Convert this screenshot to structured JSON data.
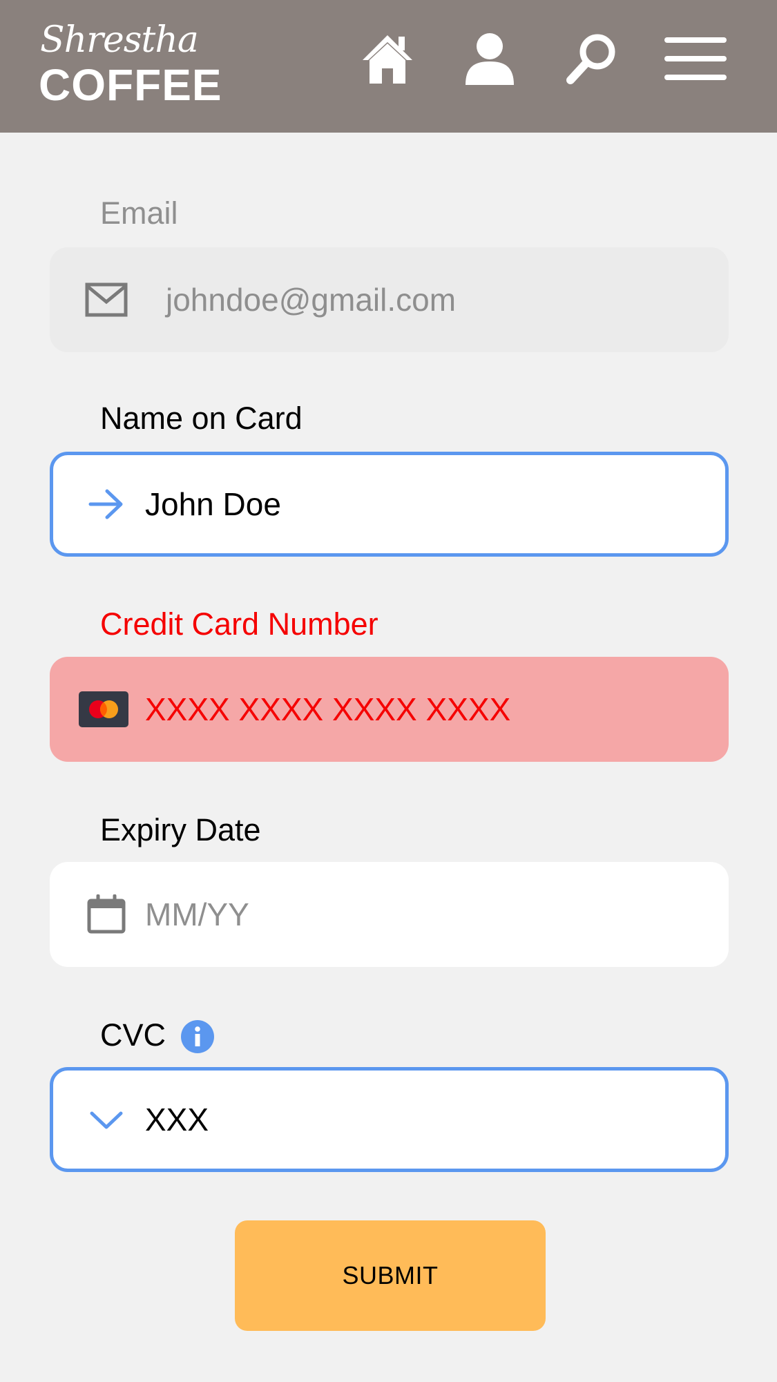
{
  "header": {
    "brand_script": "Shrestha",
    "brand_main": "COFFEE",
    "background_color": "#8a817d",
    "nav_icons": [
      "home-icon",
      "user-icon",
      "search-icon",
      "menu-icon"
    ]
  },
  "form": {
    "email": {
      "label": "Email",
      "value": "johndoe@gmail.com",
      "icon": "mail-icon",
      "state": "disabled"
    },
    "name_on_card": {
      "label": "Name on Card",
      "value": "John Doe",
      "icon": "arrow-right-icon",
      "state": "focused"
    },
    "card_number": {
      "label": "Credit Card Number",
      "value": "XXXX XXXX XXXX XXXX",
      "icon": "mastercard-icon",
      "state": "error"
    },
    "expiry": {
      "label": "Expiry Date",
      "placeholder": "MM/YY",
      "icon": "calendar-icon",
      "state": "default"
    },
    "cvc": {
      "label": "CVC",
      "value": "XXX",
      "icon": "chevron-down-icon",
      "info_icon": "info-icon",
      "state": "focused"
    },
    "submit_label": "SUBMIT"
  },
  "colors": {
    "accent": "#5b97ef",
    "error": "#f50000",
    "error_bg": "#f5a7a7",
    "submit": "#ffbb58"
  }
}
